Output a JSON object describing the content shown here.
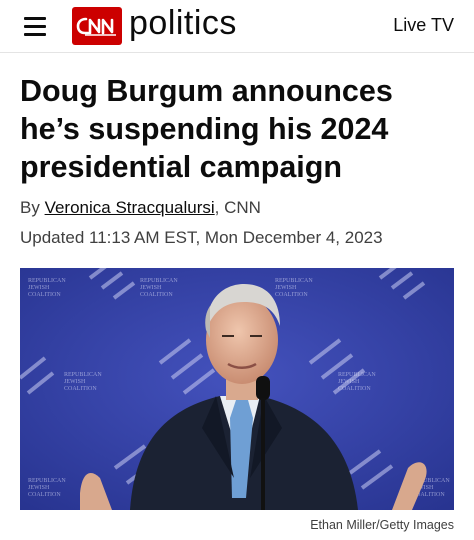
{
  "header": {
    "brand": "CNN",
    "section": "politics",
    "live_tv": "Live TV"
  },
  "article": {
    "headline": "Doug Burgum announces he’s suspending his 2024 presidential campaign",
    "byline_prefix": "By",
    "author": "Veronica Stracqualursi",
    "outlet": ", CNN",
    "updated": "Updated 11:13 AM EST, Mon December 4, 2023"
  },
  "photo": {
    "credit": "Ethan Miller/Getty Images",
    "backdrop_repeated_text": [
      "REPUBLICAN",
      "JEWISH",
      "COALITION"
    ]
  },
  "colors": {
    "brand_red": "#cc0000",
    "backdrop_blue": "#2f3ea8"
  }
}
